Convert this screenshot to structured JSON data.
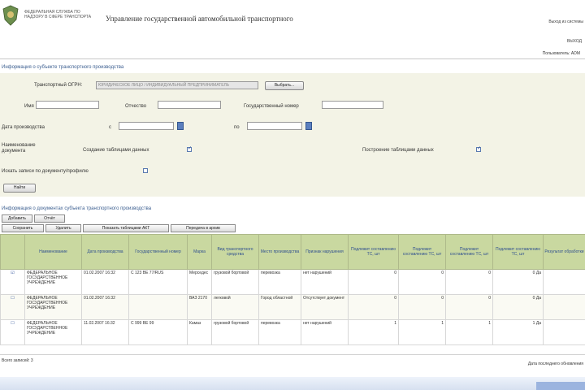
{
  "header": {
    "logo_text": "ФЕДЕРАЛЬНАЯ СЛУЖБА ПО НАДЗОРУ В СФЕРЕ ТРАНСПОРТА",
    "title": "Управление государственной автомобильной транспортного",
    "top_link": "Выход из системы",
    "top_link2": "ВЫХОД",
    "user_line": "Пользователь: ADM"
  },
  "form": {
    "section_title": "Информация о субъекте транспортного производства",
    "transport_org_label": "Транспортный ОГРН:",
    "transport_org_value": "ЮРИДИЧЕСКОЕ ЛИЦО / ИНДИВИДУАЛЬНЫЙ ПРЕДПРИНИМАТЕЛЬ",
    "choose_button": "Выбрать...",
    "name_label": "Имя",
    "patronymic_label": "Отчество",
    "state_number_label": "Государственный номер",
    "period_label": "Дата производства",
    "from_label": "с",
    "to_label": "по",
    "state_label": "Наименование документа",
    "create_checkbox_label": "Создание таблицами данных",
    "report_checkbox_label": "Построение таблицами данных",
    "search_all_label": "Искать записи по документу/профилю",
    "search_button": "Найти"
  },
  "results": {
    "title": "Информация о документах субъекта транспортного производства",
    "toolbar_row1": [
      "Добавить",
      "Отчёт"
    ],
    "toolbar_row2": [
      "Сохранить",
      "Удалить",
      "Показать таблицами АКТ",
      "Передача в архив"
    ],
    "columns": [
      "",
      "Наименование",
      "Дата производства",
      "Государственный номер",
      "Марка",
      "Вид транспортного средства",
      "Место производства",
      "Признак нарушения",
      "Подлежит составлению ТС, шт",
      "Подлежит составлению ТС, шт",
      "Подлежит составлению ТС, шт",
      "Подлежит составлению ТС, шт",
      "Результат обработки"
    ],
    "rows": [
      [
        "☑",
        "ФЕДЕРАЛЬНОЕ ГОСУДАРСТВЕННОЕ УЧРЕЖДЕНИЕ",
        "01.02.2007 16:32",
        "С 123 ВЕ 77/RUS",
        "Мерседес",
        "грузовой бортовой",
        "перевозка",
        "нет нарушений",
        "0",
        "0",
        "0",
        "0 Да"
      ],
      [
        "☐",
        "ФЕДЕРАЛЬНОЕ ГОСУДАРСТВЕННОЕ УЧРЕЖДЕНИЕ",
        "01.02.2007 16:32",
        "",
        "ВАЗ 2170",
        "легковой",
        "Город областной",
        "Отсутствует документ",
        "0",
        "0",
        "0",
        "0 Да"
      ],
      [
        "☐",
        "ФЕДЕРАЛЬНОЕ ГОСУДАРСТВЕННОЕ УЧРЕЖДЕНИЕ",
        "11.02.2007 16:32",
        "С 999 ВЕ 99",
        "Камаз",
        "грузовой бортовой",
        "перевозка",
        "нет нарушений",
        "1",
        "1",
        "1",
        "1 Да"
      ]
    ]
  },
  "footer": {
    "left": "Всего записей: 3",
    "right": "Дата последнего обновления"
  },
  "colors": {
    "header_bg": "#c9d8a0",
    "form_bg": "#f3f3e6",
    "link": "#3a5d8f"
  }
}
